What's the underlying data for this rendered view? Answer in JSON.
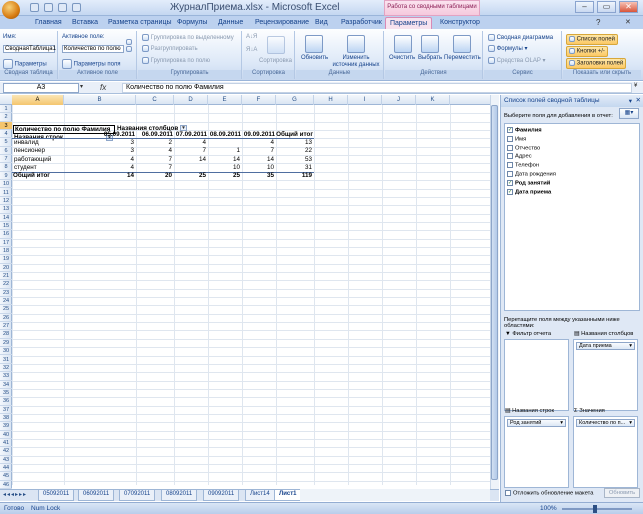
{
  "window": {
    "title": "ЖурналПриема.xlsx - Microsoft Excel",
    "context_band": "Работа со сводными таблицами",
    "buttons": [
      "–",
      "▭",
      "✕"
    ]
  },
  "tabs": [
    "Главная",
    "Вставка",
    "Разметка страницы",
    "Формулы",
    "Данные",
    "Рецензирование",
    "Вид",
    "Разработчик",
    "Параметры",
    "Конструктор"
  ],
  "active_tab": "Параметры",
  "ribbon": {
    "pivot": {
      "name_label": "Имя:",
      "name_value": "СводнаяТаблица1",
      "params": "Параметры",
      "group": "Сводная таблица"
    },
    "active_field": {
      "label": "Активное поле:",
      "value": "Количество по полю",
      "settings": "Параметры поля",
      "group": "Активное поле"
    },
    "grouping": {
      "b1": "Группировка по выделенному",
      "b2": "Разгруппировать",
      "b3": "Группировка по полю",
      "group": "Группировать"
    },
    "sort": {
      "label": "Сортировка",
      "group": "Сортировка"
    },
    "data": {
      "refresh": "Обновить",
      "change_src": "Изменить источник данных",
      "group": "Данные"
    },
    "actions": {
      "clear": "Очистить",
      "select": "Выбрать",
      "move": "Переместить",
      "group": "Действия"
    },
    "tools": {
      "chart": "Сводная диаграмма",
      "formulas": "Формулы",
      "olap": "Средства OLAP",
      "group": "Сервис"
    },
    "show": {
      "field_list": "Список полей",
      "buttons": "Кнопки +/-",
      "headers": "Заголовки полей",
      "group": "Показать или скрыть"
    }
  },
  "formula_bar": {
    "name_box": "A3",
    "fx": "fx",
    "value": "Количество по полю Фамилия"
  },
  "columns": [
    "A",
    "B",
    "C",
    "D",
    "E",
    "F",
    "G",
    "H",
    "I",
    "J",
    "K"
  ],
  "rows": [
    "1",
    "2",
    "3",
    "4",
    "5",
    "6",
    "7",
    "8",
    "9",
    "10",
    "11",
    "12",
    "13",
    "14",
    "15",
    "16",
    "17",
    "18",
    "19",
    "20",
    "21",
    "22",
    "23",
    "24",
    "25",
    "26",
    "27",
    "28",
    "29",
    "30",
    "31",
    "32",
    "33",
    "34",
    "35",
    "36",
    "37",
    "38",
    "39",
    "40",
    "41",
    "42",
    "43",
    "44",
    "45",
    "46"
  ],
  "pivot": {
    "value_header": "Количество по полю Фамилия",
    "col_header": "Названия столбцов",
    "row_header": "Названия строк",
    "dates": [
      "05.09.2011",
      "06.09.2011",
      "07.09.2011",
      "08.09.2011",
      "09.09.2011"
    ],
    "grand_col": "Общий итог",
    "data": [
      {
        "label": "инвалид",
        "vals": [
          "3",
          "2",
          "4",
          "",
          "4"
        ],
        "total": "13"
      },
      {
        "label": "пенсионер",
        "vals": [
          "3",
          "4",
          "7",
          "1",
          "7"
        ],
        "total": "22"
      },
      {
        "label": "работающий",
        "vals": [
          "4",
          "7",
          "14",
          "14",
          "14"
        ],
        "total": "53"
      },
      {
        "label": "студент",
        "vals": [
          "4",
          "7",
          "",
          "10",
          "10"
        ],
        "total": "31"
      }
    ],
    "grand_row": {
      "label": "Общий итог",
      "vals": [
        "14",
        "20",
        "25",
        "25",
        "35"
      ],
      "total": "119"
    }
  },
  "sheets": [
    "05092011",
    "06092011",
    "07092011",
    "08092011",
    "09092011",
    "Лист14",
    "Лист1"
  ],
  "status": {
    "ready": "Готово",
    "numlock": "Num Lock",
    "zoom": "100%"
  },
  "pane": {
    "title": "Список полей сводной таблицы",
    "choose_label": "Выберите поля для добавления в отчет:",
    "fields": [
      {
        "name": "Фамилия",
        "checked": true
      },
      {
        "name": "Имя",
        "checked": false
      },
      {
        "name": "Отчество",
        "checked": false
      },
      {
        "name": "Адрес",
        "checked": false
      },
      {
        "name": "Телефон",
        "checked": false
      },
      {
        "name": "Дата рождения",
        "checked": false
      },
      {
        "name": "Род занятий",
        "checked": true
      },
      {
        "name": "Дата приема",
        "checked": true
      }
    ],
    "drag_label": "Перетащите поля между указанными ниже областями:",
    "filter_label": "Фильтр отчета",
    "cols_label": "Названия столбцов",
    "cols_chip": "Дата приема",
    "rows_label": "Названия строк",
    "rows_chip": "Род занятий",
    "values_label": "Значения",
    "values_chip": "Количество по п...",
    "defer_label": "Отложить обновление макета",
    "update_btn": "Обновить"
  },
  "colors": {
    "accent": "#15428b",
    "context": "#d98ab5",
    "highlight": "#fcc864"
  },
  "icons": [
    "office-button-icon",
    "save-icon",
    "undo-icon",
    "redo-icon",
    "refresh-icon",
    "chart-icon",
    "close-icon"
  ]
}
